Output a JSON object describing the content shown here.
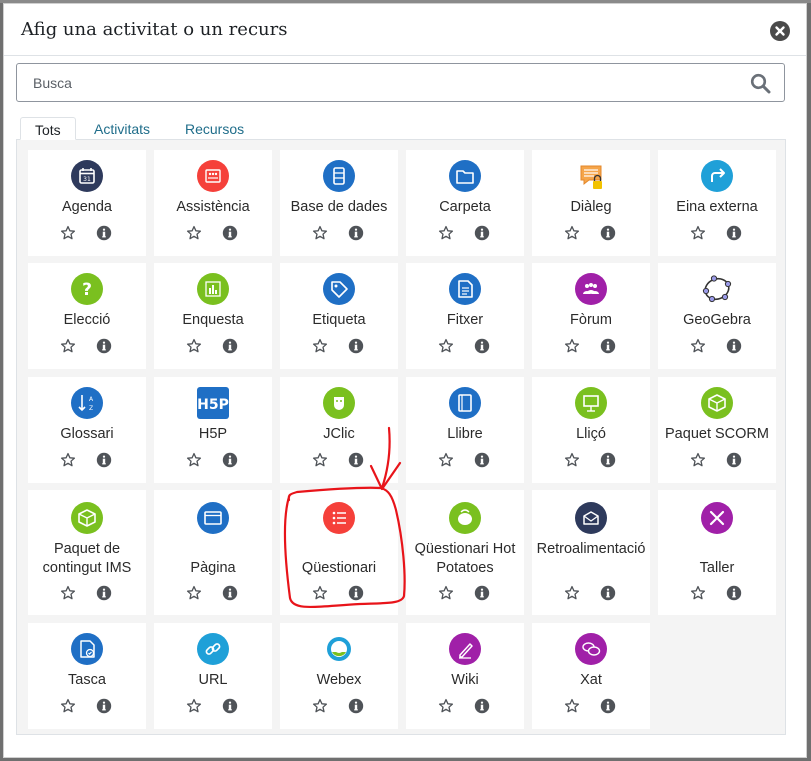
{
  "dialog": {
    "title": "Afig una activitat o un recurs",
    "search_placeholder": "Busca"
  },
  "tabs": [
    {
      "label": "Tots",
      "active": true
    },
    {
      "label": "Activitats",
      "active": false
    },
    {
      "label": "Recursos",
      "active": false
    }
  ],
  "items": [
    {
      "label": "Agenda",
      "icon": "calendar-icon",
      "color": "#2e3a5c"
    },
    {
      "label": "Assistència",
      "icon": "attendance-icon",
      "color": "#f5403a"
    },
    {
      "label": "Base de dades",
      "icon": "database-icon",
      "color": "#1f6fc5"
    },
    {
      "label": "Carpeta",
      "icon": "folder-icon",
      "color": "#1f6fc5"
    },
    {
      "label": "Diàleg",
      "icon": "dialogue-icon",
      "color": "#f5a54a"
    },
    {
      "label": "Eina externa",
      "icon": "external-tool-icon",
      "color": "#1fa0d8"
    },
    {
      "label": "Elecció",
      "icon": "choice-icon",
      "color": "#7ac01f"
    },
    {
      "label": "Enquesta",
      "icon": "survey-icon",
      "color": "#7ac01f"
    },
    {
      "label": "Etiqueta",
      "icon": "label-icon",
      "color": "#1f6fc5"
    },
    {
      "label": "Fitxer",
      "icon": "file-icon",
      "color": "#1f6fc5"
    },
    {
      "label": "Fòrum",
      "icon": "forum-icon",
      "color": "#a020a8"
    },
    {
      "label": "GeoGebra",
      "icon": "geogebra-icon",
      "color": "#6a6ad0"
    },
    {
      "label": "Glossari",
      "icon": "glossary-icon",
      "color": "#1f6fc5"
    },
    {
      "label": "H5P",
      "icon": "h5p-icon",
      "color": "#1f6fc5"
    },
    {
      "label": "JClic",
      "icon": "jclic-icon",
      "color": "#7ac01f"
    },
    {
      "label": "Llibre",
      "icon": "book-icon",
      "color": "#1f6fc5"
    },
    {
      "label": "Lliçó",
      "icon": "lesson-icon",
      "color": "#7ac01f"
    },
    {
      "label": "Paquet SCORM",
      "icon": "scorm-icon",
      "color": "#7ac01f"
    },
    {
      "label": "Paquet de contingut IMS",
      "icon": "ims-package-icon",
      "color": "#7ac01f"
    },
    {
      "label": "Pàgina",
      "icon": "page-icon",
      "color": "#1f6fc5"
    },
    {
      "label": "Qüestionari",
      "icon": "quiz-icon",
      "color": "#f5403a"
    },
    {
      "label": "Qüestionari Hot Potatoes",
      "icon": "hotpotatoes-icon",
      "color": "#7ac01f"
    },
    {
      "label": "Retroalimentació",
      "icon": "feedback-icon",
      "color": "#2e3a5c"
    },
    {
      "label": "Taller",
      "icon": "workshop-icon",
      "color": "#a020a8"
    },
    {
      "label": "Tasca",
      "icon": "assignment-icon",
      "color": "#1f6fc5"
    },
    {
      "label": "URL",
      "icon": "url-icon",
      "color": "#1fa0d8"
    },
    {
      "label": "Webex",
      "icon": "webex-icon",
      "color": "#1fa0d8"
    },
    {
      "label": "Wiki",
      "icon": "wiki-icon",
      "color": "#a020a8"
    },
    {
      "label": "Xat",
      "icon": "chat-icon",
      "color": "#a020a8"
    }
  ]
}
